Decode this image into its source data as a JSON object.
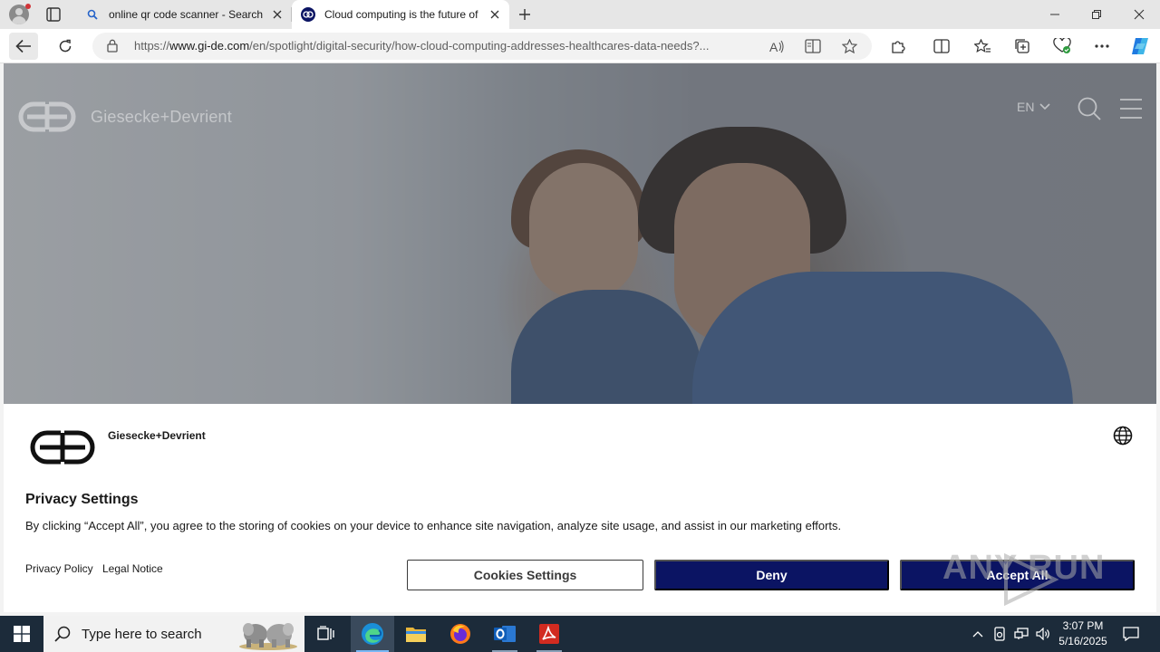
{
  "browser": {
    "tabs": [
      {
        "title": "online qr code scanner - Search",
        "favicon": "search-icon"
      },
      {
        "title": "Cloud computing is the future of",
        "favicon": "gd-logo-icon"
      }
    ],
    "url_prefix": "https://",
    "url_domain": "www.gi-de.com",
    "url_path": "/en/spotlight/digital-security/how-cloud-computing-addresses-healthcares-data-needs?..."
  },
  "site": {
    "brand": "Giesecke+Devrient",
    "language": "EN"
  },
  "cookie_banner": {
    "brand": "Giesecke+Devrient",
    "title": "Privacy Settings",
    "text": "By clicking “Accept All”, you agree to the storing of cookies on your device to enhance site navigation, analyze site usage, and assist in our marketing efforts.",
    "links": [
      "Privacy Policy",
      "Legal Notice"
    ],
    "buttons": {
      "settings": "Cookies Settings",
      "deny": "Deny",
      "accept": "Accept All"
    }
  },
  "watermark": "ANY RUN",
  "taskbar": {
    "search_placeholder": "Type here to search",
    "time": "3:07 PM",
    "date": "5/16/2025"
  },
  "colors": {
    "accent_button": "#0b1463",
    "taskbar": "#1c2b3a"
  }
}
